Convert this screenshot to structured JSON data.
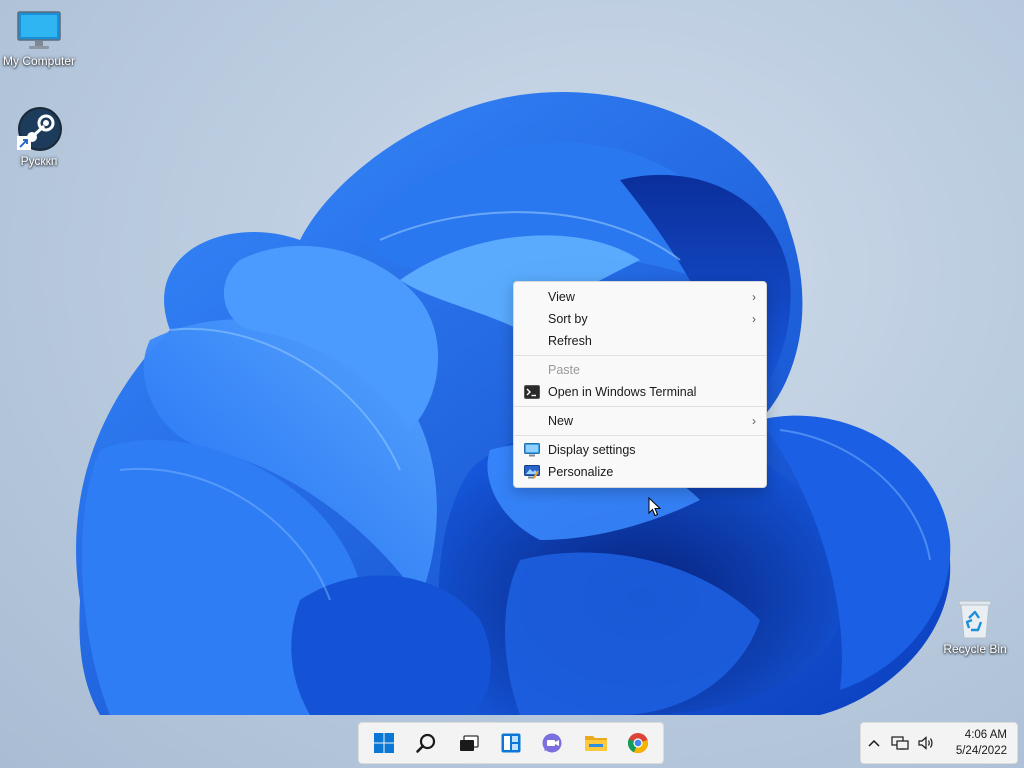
{
  "desktop": {
    "icons": [
      {
        "label": "My Computer",
        "icon": "monitor-icon"
      },
      {
        "label": "Русккп",
        "icon": "steam-icon"
      },
      {
        "label": "Recycle Bin",
        "icon": "recycle-bin-icon"
      }
    ]
  },
  "context_menu": {
    "items": [
      {
        "label": "View",
        "submenu": true
      },
      {
        "label": "Sort by",
        "submenu": true
      },
      {
        "label": "Refresh"
      },
      {
        "label": "Paste",
        "disabled": true
      },
      {
        "label": "Open in Windows Terminal",
        "icon": "terminal-icon"
      },
      {
        "label": "New",
        "submenu": true
      },
      {
        "label": "Display settings",
        "icon": "display-icon"
      },
      {
        "label": "Personalize",
        "icon": "personalize-icon"
      }
    ],
    "chevron": "›"
  },
  "taskbar": {
    "buttons": [
      "windows-start-icon",
      "search-icon",
      "task-view-icon",
      "widgets-icon",
      "teams-chat-icon",
      "file-explorer-icon",
      "chrome-icon"
    ]
  },
  "tray": {
    "overflow_chevron": "^",
    "time": "4:06 AM",
    "date": "5/24/2022"
  },
  "colors": {
    "accent": "#0067c0",
    "wallpaper_bloom": "#1a66e0"
  }
}
